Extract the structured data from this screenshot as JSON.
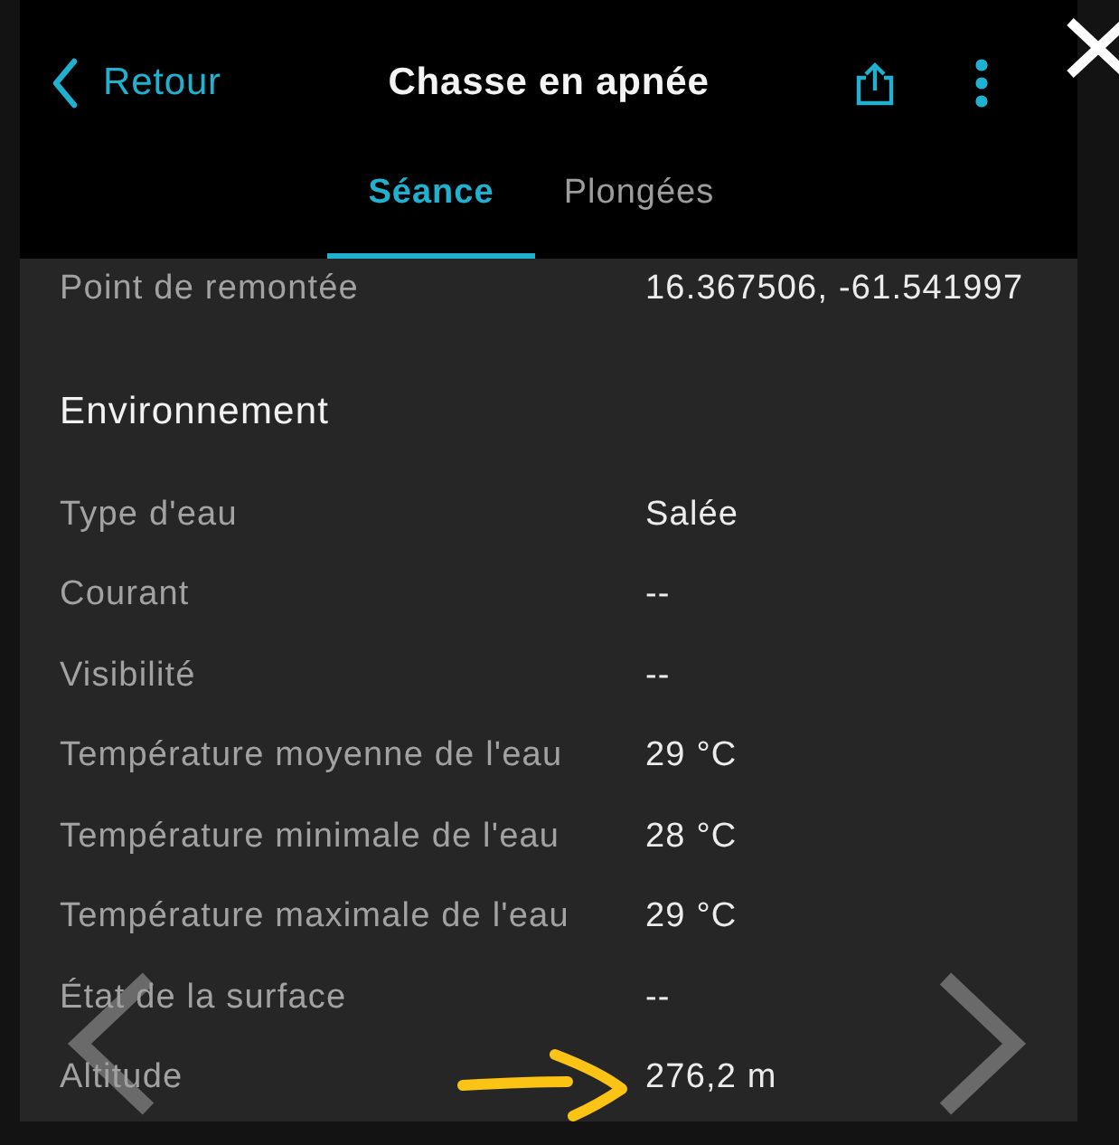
{
  "header": {
    "back_label": "Retour",
    "title": "Chasse en apnée"
  },
  "tabs": [
    {
      "label": "Séance",
      "selected": true
    },
    {
      "label": "Plongées",
      "selected": false
    }
  ],
  "rows": [
    {
      "kind": "field",
      "label": "Point de remontée",
      "value": "16.367506, -61.541997",
      "annotated": false
    },
    {
      "kind": "heading",
      "label": "Environnement"
    },
    {
      "kind": "field",
      "label": "Type d'eau",
      "value": "Salée",
      "annotated": false
    },
    {
      "kind": "field",
      "label": "Courant",
      "value": "--",
      "annotated": false
    },
    {
      "kind": "field",
      "label": "Visibilité",
      "value": "--",
      "annotated": false
    },
    {
      "kind": "field",
      "label": "Température moyenne de l'eau",
      "value": "29 °C",
      "annotated": false
    },
    {
      "kind": "field",
      "label": "Température minimale de l'eau",
      "value": "28 °C",
      "annotated": false
    },
    {
      "kind": "field",
      "label": "Température maximale de l'eau",
      "value": "29 °C",
      "annotated": false
    },
    {
      "kind": "field",
      "label": "État de la surface",
      "value": "--",
      "annotated": false
    },
    {
      "kind": "field",
      "label": "Altitude",
      "value": "276,2 m",
      "annotated": true
    }
  ]
}
